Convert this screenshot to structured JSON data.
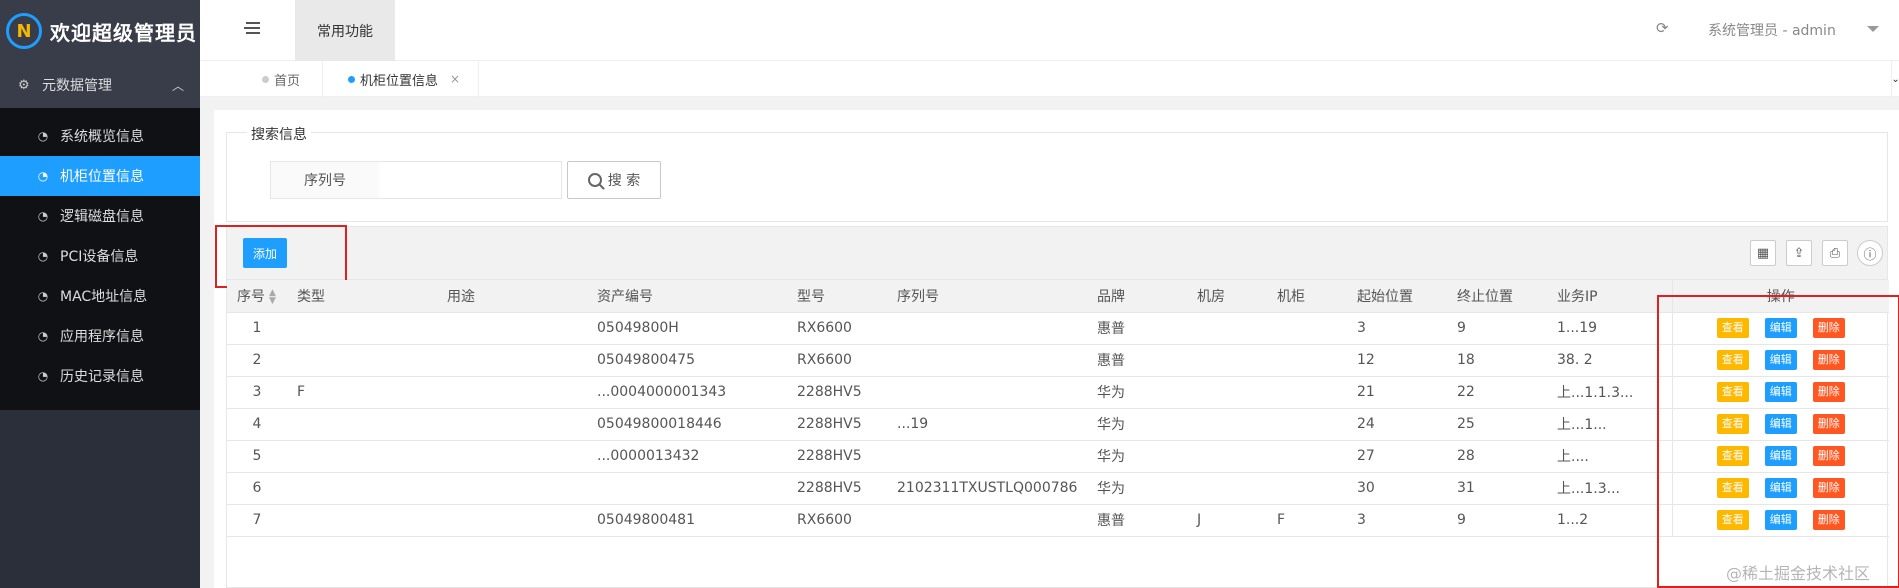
{
  "app": {
    "title": "欢迎超级管理员",
    "logo_letter": "N"
  },
  "sidebar": {
    "group_label": "元数据管理",
    "items": [
      {
        "label": "系统概览信息",
        "active": false
      },
      {
        "label": "机柜位置信息",
        "active": true
      },
      {
        "label": "逻辑磁盘信息",
        "active": false
      },
      {
        "label": "PCI设备信息",
        "active": false
      },
      {
        "label": "MAC地址信息",
        "active": false
      },
      {
        "label": "应用程序信息",
        "active": false
      },
      {
        "label": "历史记录信息",
        "active": false
      }
    ]
  },
  "header": {
    "quick_tab": "常用功能",
    "user": "系统管理员 - admin"
  },
  "tabs": [
    {
      "label": "首页",
      "active": false
    },
    {
      "label": "机柜位置信息",
      "active": true,
      "close": "×"
    }
  ],
  "search": {
    "legend": "搜索信息",
    "field_label": "序列号",
    "input_value": "",
    "button_label": "搜 索"
  },
  "toolbar": {
    "add_label": "添加"
  },
  "table": {
    "columns": [
      "序号",
      "类型",
      "用途",
      "资产编号",
      "型号",
      "序列号",
      "品牌",
      "机房",
      "机柜",
      "起始位置",
      "终止位置",
      "业务IP",
      "操作"
    ],
    "rows": [
      {
        "no": "1",
        "type": "",
        "usage": "",
        "asset": "05049800H",
        "model": "RX6600",
        "serial": "",
        "brand": "惠普",
        "room": "",
        "cabinet": "",
        "start": "3",
        "end": "9",
        "ip": "1...19"
      },
      {
        "no": "2",
        "type": "",
        "usage": "",
        "asset": "05049800475",
        "model": "RX6600",
        "serial": "",
        "brand": "惠普",
        "room": "",
        "cabinet": "",
        "start": "12",
        "end": "18",
        "ip": "38.  2"
      },
      {
        "no": "3",
        "type": "F",
        "usage": "",
        "asset": "...0004000001343",
        "model": "2288HV5",
        "serial": "",
        "brand": "华为",
        "room": "",
        "cabinet": "",
        "start": "21",
        "end": "22",
        "ip": "上...1.1.3..."
      },
      {
        "no": "4",
        "type": "",
        "usage": "",
        "asset": "05049800018446",
        "model": "2288HV5",
        "serial": "...19",
        "brand": "华为",
        "room": "",
        "cabinet": "",
        "start": "24",
        "end": "25",
        "ip": "上...1..."
      },
      {
        "no": "5",
        "type": "",
        "usage": "",
        "asset": "...0000013432",
        "model": "2288HV5",
        "serial": "",
        "brand": "华为",
        "room": "",
        "cabinet": "",
        "start": "27",
        "end": "28",
        "ip": "上...."
      },
      {
        "no": "6",
        "type": "",
        "usage": "",
        "asset": "",
        "model": "2288HV5",
        "serial": "2102311TXUSTLQ000786",
        "brand": "华为",
        "room": "",
        "cabinet": "",
        "start": "30",
        "end": "31",
        "ip": "上...1.3..."
      },
      {
        "no": "7",
        "type": "",
        "usage": "",
        "asset": "05049800481",
        "model": "RX6600",
        "serial": "",
        "brand": "惠普",
        "room": "J",
        "cabinet": "F",
        "start": "3",
        "end": "9",
        "ip": "1...2"
      }
    ],
    "ops": {
      "view": "查看",
      "edit": "编辑",
      "delete": "删除"
    }
  },
  "watermark": "@稀土掘金技术社区",
  "colors": {
    "accent": "#1e9fff",
    "view": "#ffb800",
    "delete": "#ff5722",
    "highlight": "#e02020",
    "sidebar": "#2b2f3a"
  },
  "icons": [
    "logo-icon",
    "gear-icon",
    "chevron-up-icon",
    "dashboard-icon",
    "hamburger-icon",
    "refresh-icon",
    "caret-down-icon",
    "close-icon",
    "search-icon",
    "columns-icon",
    "export-icon",
    "print-icon",
    "info-icon",
    "sort-icon"
  ]
}
